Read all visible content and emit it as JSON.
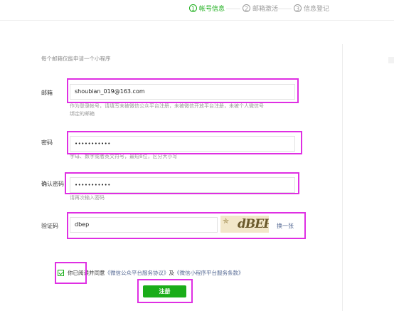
{
  "steps": [
    {
      "num": "1",
      "label": "帐号信息",
      "active": true
    },
    {
      "num": "2",
      "label": "邮箱激活",
      "active": false
    },
    {
      "num": "3",
      "label": "信息登记",
      "active": false
    }
  ],
  "form": {
    "tip": "每个邮箱仅能申请一个小程序",
    "email": {
      "label": "邮箱",
      "value": "shoubian_019@163.com",
      "hint_line1": "作为登录帐号，请填写未被微信公众平台注册，未被微信开放平台注册，未被个人微信号",
      "hint_line2": "绑定的邮箱"
    },
    "password": {
      "label": "密码",
      "value": "•••••••••••",
      "hint": "字母、数字或者英文符号，最短8位，区分大小写"
    },
    "confirm_password": {
      "label": "确认密码",
      "value": "•••••••••••",
      "hint": "请再次输入密码"
    },
    "captcha": {
      "label": "验证码",
      "value": "dbep",
      "image_text": "dBEP",
      "refresh_label": "换一张"
    },
    "agreement": {
      "prefix": "你已阅读并同意",
      "link1": "《微信公众平台服务协议》",
      "connector": "及",
      "link2": "《微信小程序平台服务条款》",
      "checked": true
    },
    "register_label": "注册"
  },
  "colors": {
    "accent": "#1aad19",
    "link": "#576b95",
    "highlight": "#df2fe3"
  }
}
